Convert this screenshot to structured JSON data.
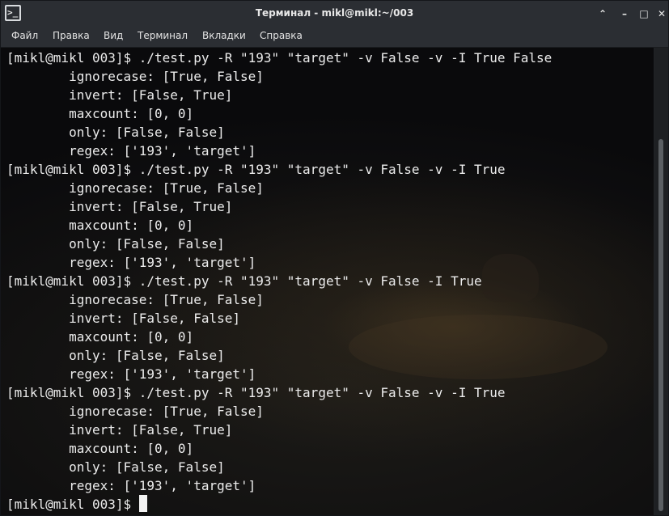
{
  "window": {
    "title": "Терминал - mikl@mikl:~/003",
    "app_icon_glyph": ">_",
    "controls": {
      "chevron": "⌃",
      "minimize": "–",
      "maximize": "□",
      "close": "✕"
    }
  },
  "menu": {
    "items": [
      "Файл",
      "Правка",
      "Вид",
      "Терминал",
      "Вкладки",
      "Справка"
    ]
  },
  "terminal": {
    "lines": [
      "[mikl@mikl 003]$ ./test.py -R \"193\" \"target\" -v False -v -I True False",
      "        ignorecase: [True, False]",
      "        invert: [False, True]",
      "        maxcount: [0, 0]",
      "        only: [False, False]",
      "        regex: ['193', 'target']",
      "[mikl@mikl 003]$ ./test.py -R \"193\" \"target\" -v False -v -I True",
      "        ignorecase: [True, False]",
      "        invert: [False, True]",
      "        maxcount: [0, 0]",
      "        only: [False, False]",
      "        regex: ['193', 'target']",
      "[mikl@mikl 003]$ ./test.py -R \"193\" \"target\" -v False -I True",
      "        ignorecase: [True, False]",
      "        invert: [False, False]",
      "        maxcount: [0, 0]",
      "        only: [False, False]",
      "        regex: ['193', 'target']",
      "[mikl@mikl 003]$ ./test.py -R \"193\" \"target\" -v False -v -I True",
      "        ignorecase: [True, False]",
      "        invert: [False, True]",
      "        maxcount: [0, 0]",
      "        only: [False, False]",
      "        regex: ['193', 'target']"
    ],
    "prompt": "[mikl@mikl 003]$ "
  },
  "colors": {
    "text": "#ececec",
    "titlebar": "#2b2e33"
  }
}
